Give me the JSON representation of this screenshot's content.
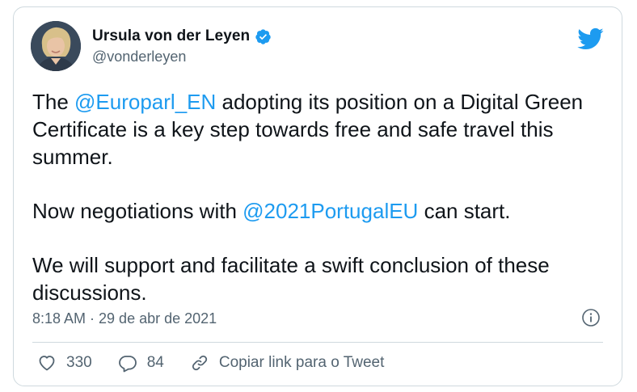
{
  "author": {
    "display_name": "Ursula von der Leyen",
    "handle": "@vonderleyen",
    "verified": true,
    "avatar_icon": "avatar-photo"
  },
  "tweet": {
    "p1_before": "The ",
    "p1_mention": "@Europarl_EN",
    "p1_after": " adopting its position on a Digital Green Certificate is a key step towards free and safe travel this summer.",
    "p2_before": "Now negotiations with ",
    "p2_mention": "@2021PortugalEU",
    "p2_after": " can start.",
    "p3": "We will support and facilitate a swift conclusion of these discussions."
  },
  "meta": {
    "timestamp": "8:18 AM · 29 de abr de 2021"
  },
  "actions": {
    "likes_count": "330",
    "replies_count": "84",
    "copy_link_label": "Copiar link para o Tweet"
  },
  "icons": {
    "like": "heart-icon",
    "reply": "reply-bubble-icon",
    "copy_link": "link-icon",
    "info": "info-icon",
    "brand": "twitter-bird-icon",
    "verified": "verified-badge-icon"
  },
  "colors": {
    "brand_blue": "#1d9bf0",
    "text_primary": "#0f1419",
    "text_secondary": "#536471",
    "border": "#cfd9de"
  }
}
